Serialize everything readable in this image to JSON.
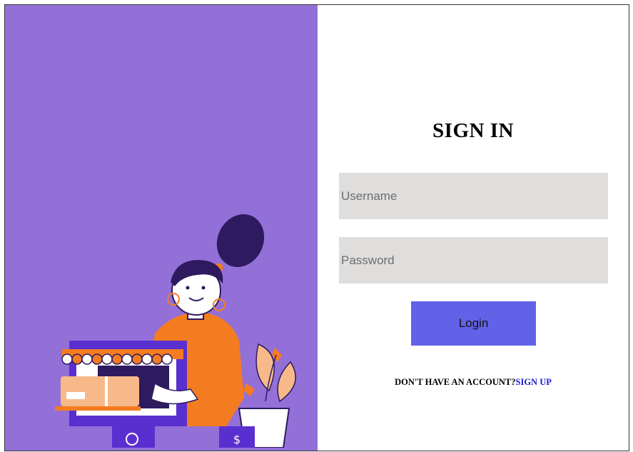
{
  "form": {
    "title": "SIGN IN",
    "username_placeholder": "Username",
    "password_placeholder": "Password",
    "login_label": "Login",
    "no_account_text": "DON'T HAVE AN ACCOUNT?",
    "signup_label": "SIGN UP"
  },
  "colors": {
    "left_panel_bg": "#9370d8",
    "input_bg": "#e0dddd",
    "login_button_bg": "#6262e8",
    "signup_link": "#1a1ad6"
  },
  "illustration": {
    "icon": "shopkeeper-illustration"
  }
}
